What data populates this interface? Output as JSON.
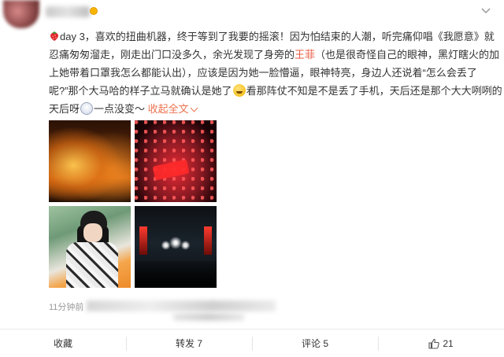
{
  "post": {
    "text_part1": "day 3，喜欢的扭曲机器，终于等到了我要的摇滚！因为怕结束的人潮，听完痛仰唱《我愿意》就忍痛匆匆溜走，刚走出门口没多久，余光发现了身旁的",
    "highlight_name": "王菲",
    "text_part2": "（也是很奇怪自己的眼神，黑灯瞎火的加上她带着口罩我怎么都能认出），应该是因为她一脸懵逼，眼神特亮，身边人还说着“怎么会丢了呢?”那个大马哈的样子立马就确认是她了",
    "text_part3": "看那阵仗不知是不是丢了手机，天后还是那个大大咧咧的天后呀",
    "text_part4": "一点没变～",
    "expand_label": "收起全文",
    "timestamp": "11分钟前",
    "accent_color": "#eb7350",
    "highlight_color": "#e8593f"
  },
  "icons": {
    "leading_emoji": "strawberry-icon",
    "inline_emoji_1": "laughing-emoji-icon",
    "inline_emoji_2": "sticker-icon",
    "more": "chevron-down-icon",
    "like": "thumbs-up-icon"
  },
  "actions": {
    "favorite_label": "收藏",
    "repost_label": "转发 7",
    "comment_label": "评论 5",
    "like_count": "21"
  }
}
